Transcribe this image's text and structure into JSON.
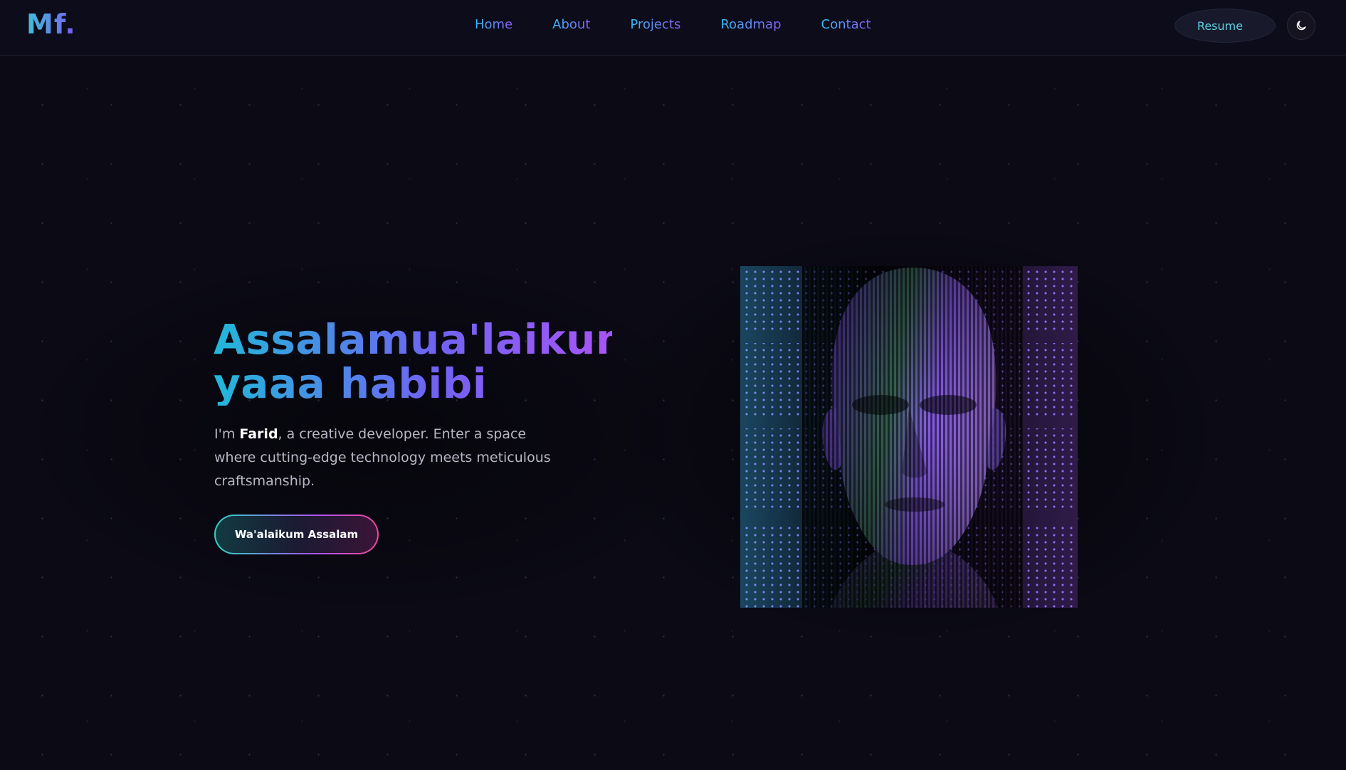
{
  "header": {
    "logo": "Mf.",
    "nav": [
      "Home",
      "About",
      "Projects",
      "Roadmap",
      "Contact"
    ],
    "resume_label": "Resume",
    "theme_toggle_icon": "moon-icon"
  },
  "hero": {
    "title_line1": "Assalamua'laikum",
    "title_line2": "yaaa habibi",
    "intro_prefix": "I'm ",
    "intro_name": "Farid",
    "intro_suffix": ", a creative developer. Enter a space where cutting-edge technology meets meticulous craftsmanship.",
    "cta_label": "Wa'alaikum Assalam"
  },
  "colors": {
    "background": "#0b0a15",
    "accent_cyan": "#22b8d9",
    "accent_purple": "#a855f7",
    "accent_pink": "#ec4899"
  }
}
